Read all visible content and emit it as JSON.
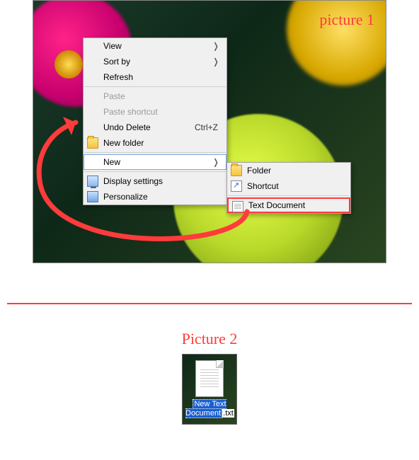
{
  "labels": {
    "picture1": "picture 1",
    "picture2": "Picture 2"
  },
  "mainMenu": {
    "view": "View",
    "sortBy": "Sort by",
    "refresh": "Refresh",
    "paste": "Paste",
    "pasteShortcut": "Paste shortcut",
    "undoDelete": "Undo Delete",
    "undoDeleteShortcut": "Ctrl+Z",
    "newFolder": "New folder",
    "new": "New",
    "displaySettings": "Display settings",
    "personalize": "Personalize"
  },
  "submenu": {
    "folder": "Folder",
    "shortcut": "Shortcut",
    "textDocument": "Text Document"
  },
  "newFile": {
    "nameSelected": "New Text Document",
    "ext": ".txt"
  },
  "icons": {
    "chevron": "❭"
  }
}
